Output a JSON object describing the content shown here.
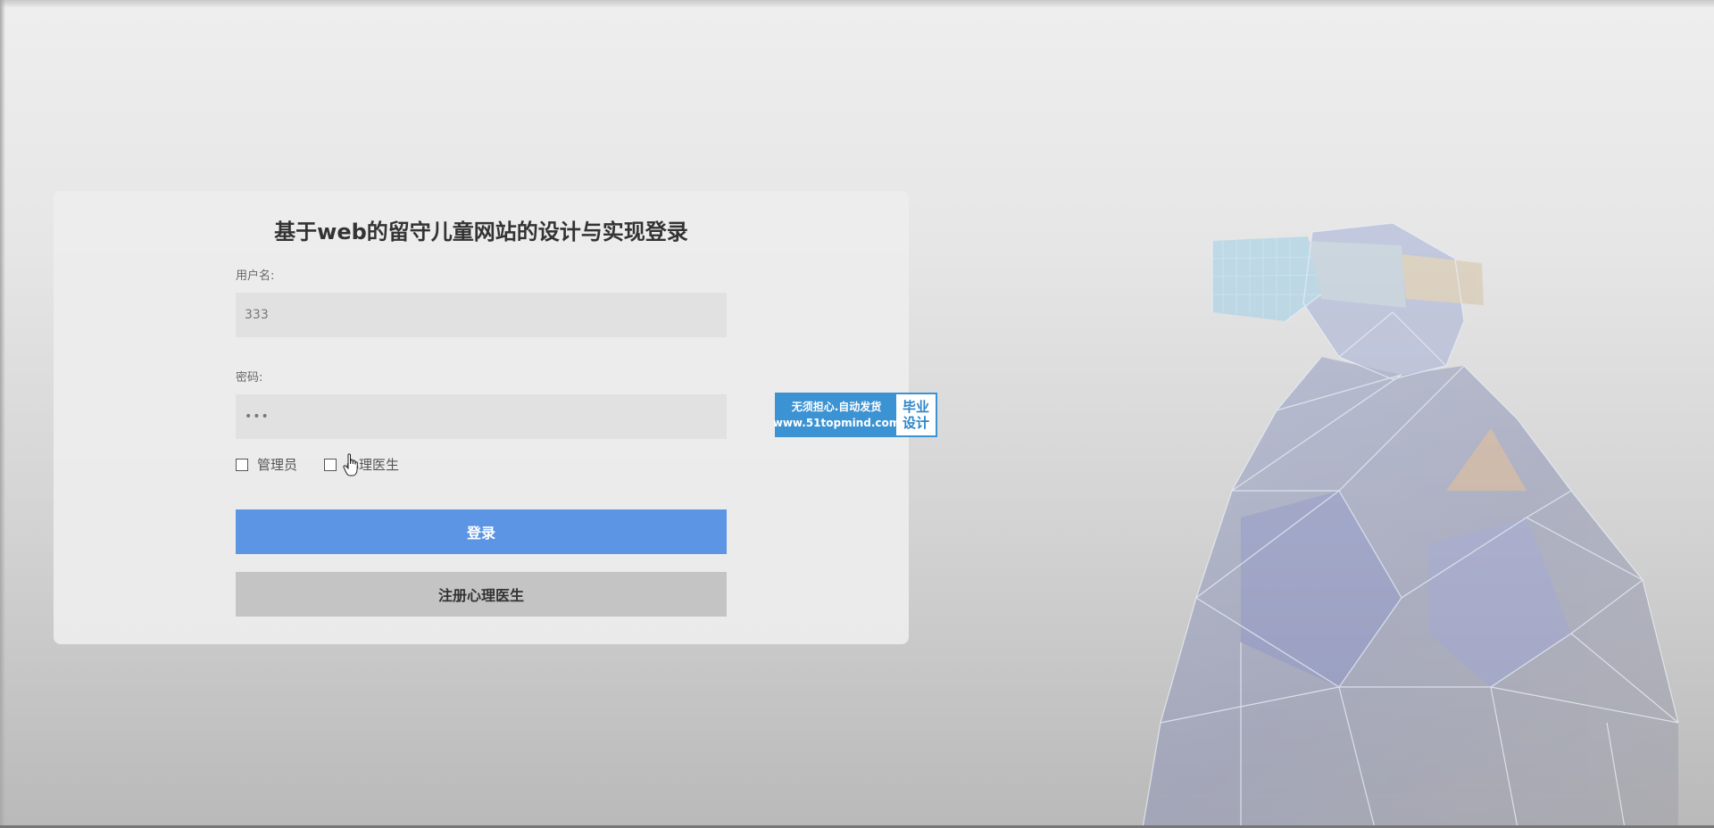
{
  "login": {
    "title": "基于web的留守儿童网站的设计与实现登录",
    "username_label": "用户名:",
    "username_value": "333",
    "password_label": "密码:",
    "password_value": "•••",
    "roles": [
      {
        "label": "管理员",
        "checked": false
      },
      {
        "label": "心理医生",
        "checked": false
      }
    ],
    "login_button": "登录",
    "register_button": "注册心理医生"
  },
  "badge": {
    "line1": "无须担心.自动发货",
    "line2": "www.51topmind.com",
    "right_line1": "毕业",
    "right_line2": "设计"
  },
  "colors": {
    "login_button": "#5b95e3",
    "register_button": "#c4c4c4",
    "badge_blue": "#3c93d3"
  }
}
